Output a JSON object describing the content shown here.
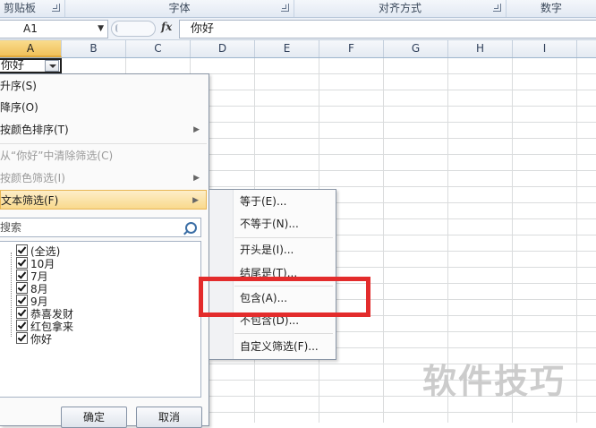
{
  "ribbon": {
    "groups": [
      "剪贴板",
      "字体",
      "对齐方式",
      "数字"
    ]
  },
  "formula_bar": {
    "name_box": "A1",
    "fx_label": "fx",
    "content": "你好"
  },
  "columns": [
    "A",
    "B",
    "C",
    "D",
    "E",
    "F",
    "G",
    "H",
    "I"
  ],
  "cell_a1": "你好",
  "filter_menu": {
    "items": [
      {
        "label": "升序(S)",
        "enabled": true
      },
      {
        "label": "降序(O)",
        "enabled": true
      },
      {
        "label": "按颜色排序(T)",
        "enabled": true
      },
      {
        "label": "从“你好”中清除筛选(C)",
        "enabled": false
      },
      {
        "label": "按颜色筛选(I)",
        "enabled": false
      },
      {
        "label": "文本筛选(F)",
        "enabled": true
      }
    ],
    "search_placeholder": "搜索",
    "list": [
      "(全选)",
      "10月",
      "7月",
      "8月",
      "9月",
      "恭喜发财",
      "红包拿来",
      "你好"
    ],
    "ok_label": "确定",
    "cancel_label": "取消"
  },
  "text_filter_submenu": {
    "items": [
      "等于(E)...",
      "不等于(N)...",
      "开头是(I)...",
      "结尾是(T)...",
      "包含(A)...",
      "不包含(D)...",
      "自定义筛选(F)..."
    ]
  },
  "watermark": "软件技巧",
  "colors": {
    "highlight_box": "#e32c2c",
    "menu_hover": "#f9d98c",
    "active_column": "#f1c15a"
  }
}
